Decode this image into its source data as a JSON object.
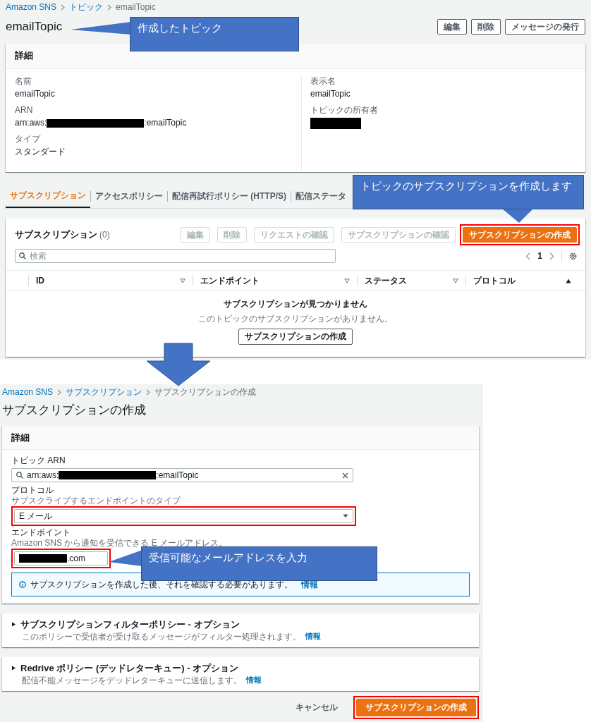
{
  "top": {
    "breadcrumb": [
      {
        "label": "Amazon SNS",
        "link": true
      },
      {
        "label": "トピック",
        "link": true
      },
      {
        "label": "emailTopic",
        "link": false
      }
    ],
    "title": "emailTopic",
    "actions": [
      "編集",
      "削除",
      "メッセージの発行"
    ],
    "details": {
      "heading": "詳細",
      "left": [
        {
          "kind": "text",
          "label": "名前",
          "value": "emailTopic"
        },
        {
          "kind": "arn",
          "label": "ARN",
          "prefix": "arn:aws:",
          "suffix": ":emailTopic"
        },
        {
          "kind": "text",
          "label": "タイプ",
          "value": "スタンダード"
        }
      ],
      "right": [
        {
          "kind": "text",
          "label": "表示名",
          "value": "emailTopic"
        },
        {
          "kind": "redacted",
          "label": "トピックの所有者"
        }
      ]
    },
    "tabs": [
      {
        "label": "サブスクリプション",
        "selected": true
      },
      {
        "label": "アクセスポリシー",
        "selected": false
      },
      {
        "label": "配信再試行ポリシー (HTTP/S)",
        "selected": false
      },
      {
        "label": "配信ステータ",
        "selected": false
      }
    ],
    "subscriptions": {
      "heading": "サブスクリプション",
      "count": "(0)",
      "actions": [
        {
          "label": "編集",
          "kind": "normal",
          "disabled": true,
          "highlighted": false
        },
        {
          "label": "削除",
          "kind": "normal",
          "disabled": true,
          "highlighted": false
        },
        {
          "label": "リクエストの確認",
          "kind": "normal",
          "disabled": true,
          "highlighted": false
        },
        {
          "label": "サブスクリプションの確認",
          "kind": "normal",
          "disabled": true,
          "highlighted": false
        },
        {
          "label": "サブスクリプションの作成",
          "kind": "primary",
          "disabled": false,
          "highlighted": true
        }
      ],
      "search": {
        "placeholder": "検索"
      },
      "page": "1",
      "columns": [
        {
          "label": "ID",
          "sorted_ascending": false
        },
        {
          "label": "エンドポイント",
          "sorted_ascending": false
        },
        {
          "label": "ステータス",
          "sorted_ascending": false
        },
        {
          "label": "プロトコル",
          "sorted_ascending": true
        }
      ],
      "empty_title": "サブスクリプションが見つかりません",
      "empty_text": "このトピックのサブスクリプションがありません。",
      "empty_button": "サブスクリプションの作成"
    }
  },
  "bottom": {
    "breadcrumb": [
      {
        "label": "Amazon SNS",
        "link": true
      },
      {
        "label": "サブスクリプション",
        "link": true
      },
      {
        "label": "サブスクリプションの作成",
        "link": false
      }
    ],
    "title": "サブスクリプションの作成",
    "details": {
      "heading": "詳細",
      "topic_arn": {
        "label": "トピック ARN",
        "prefix": "arn:aws:",
        "suffix": ":emailTopic"
      },
      "protocol": {
        "label": "プロトコル",
        "description": "サブスクライブするエンドポイントのタイプ",
        "value": "E メール",
        "highlighted": true
      },
      "endpoint": {
        "label": "エンドポイント",
        "description": "Amazon SNS から通知を受信できる E メールアドレス。",
        "suffix": ".com",
        "highlighted": true
      },
      "alert": {
        "text": "サブスクリプションを作成した後、それを確認する必要があります。",
        "link": "情報"
      }
    },
    "sections": [
      {
        "title": "サブスクリプションフィルターポリシー - オプション",
        "description": "このポリシーで受信者が受け取るメッセージがフィルター処理されます。",
        "link": "情報",
        "expanded": false
      },
      {
        "title": "Redrive ポリシー (デッドレターキュー) - オプション",
        "description": "配信不能メッセージをデッドレターキューに送信します。",
        "link": "情報",
        "expanded": false
      }
    ],
    "cancel": "キャンセル",
    "submit": {
      "label": "サブスクリプションの作成",
      "highlighted": true
    }
  },
  "annotations": [
    {
      "text": "作成したトピック"
    },
    {
      "text": "トピックのサブスクリプションを作成します"
    },
    {
      "text": "受信可能なメールアドレスを入力"
    }
  ]
}
